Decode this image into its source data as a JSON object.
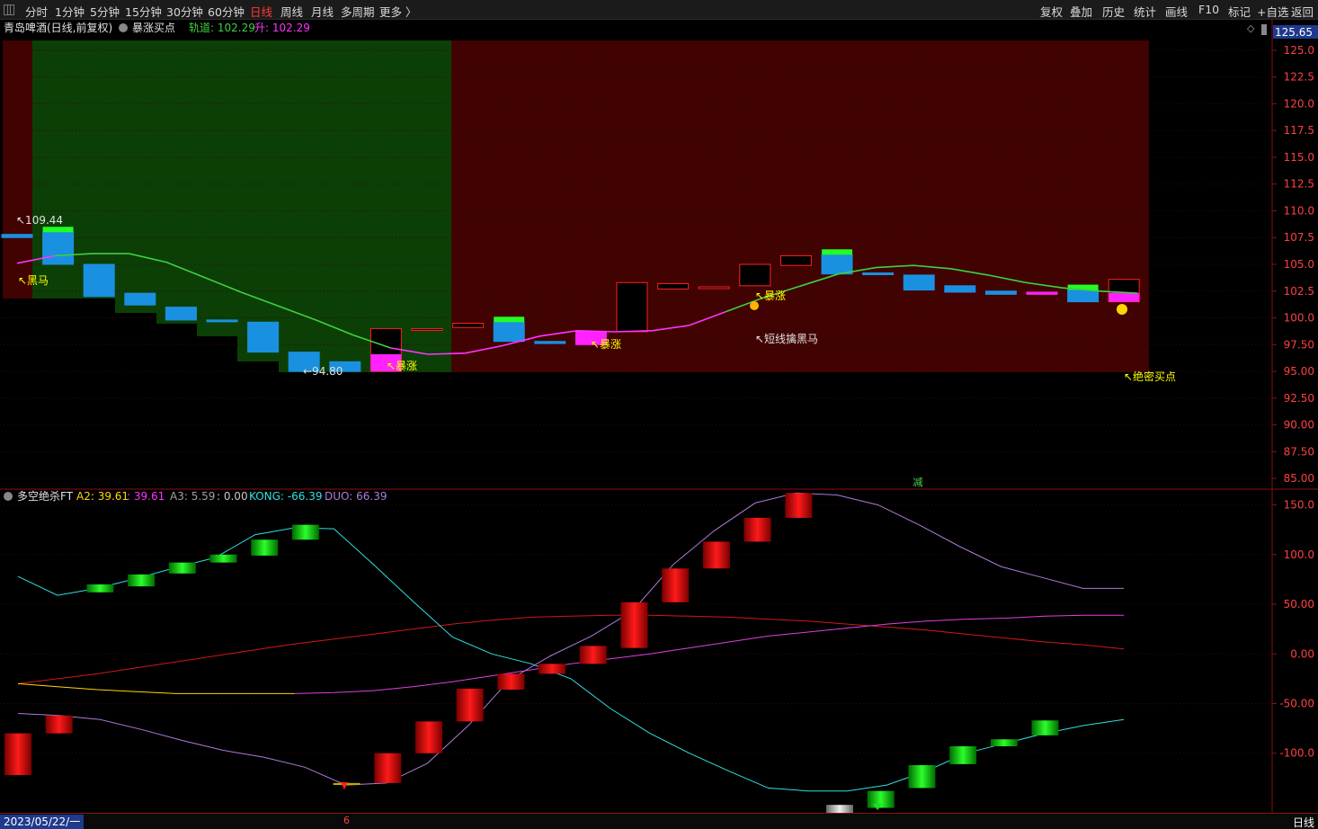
{
  "toolbar": {
    "left": [
      "分时",
      "1分钟",
      "5分钟",
      "15分钟",
      "30分钟",
      "60分钟",
      "日线",
      "周线",
      "月线",
      "多周期",
      "更多 〉"
    ],
    "right": [
      "复权",
      "叠加",
      "历史",
      "统计",
      "画线",
      "F10",
      "标记",
      "+自选",
      "返回"
    ],
    "active": "日线"
  },
  "main_panel": {
    "stock_title": "青岛啤酒(日线,前复权)",
    "indicator_name": "暴涨买点",
    "legend": [
      {
        "label": "轨道: 102.29",
        "color": "#3ed13e"
      },
      {
        "label": "升: 102.29",
        "color": "#ff34ff"
      }
    ],
    "current_price_tag": "125.65",
    "y_axis": {
      "min": 84,
      "max": 126,
      "ticks": [
        "125.0",
        "122.5",
        "120.0",
        "117.5",
        "115.0",
        "112.5",
        "110.0",
        "107.5",
        "105.0",
        "102.5",
        "100.0",
        "97.50",
        "95.00",
        "92.50",
        "90.00",
        "87.50",
        "85.00"
      ]
    },
    "annotations": {
      "high": "109.44",
      "low": "94.80",
      "heima": "黑马",
      "baozhang": "暴涨",
      "short_line": "短线擒黑马",
      "secret_point": "绝密买点",
      "reduce": "减"
    }
  },
  "sub_panel": {
    "indicator_name": "多空绝杀FT",
    "legend": [
      {
        "label": "A2: 39.61",
        "color": "#ffd700"
      },
      {
        "label": ": 39.61",
        "color": "#ff34ff"
      },
      {
        "label": "A3: 5.59",
        "color": "#a0a0a0"
      },
      {
        "label": ": 0.00",
        "color": "#c8c8c8"
      },
      {
        "label": "KONG: -66.39",
        "color": "#2fe0e0"
      },
      {
        "label": "DUO: 66.39",
        "color": "#b07ad8"
      }
    ],
    "y_axis": {
      "min": -160,
      "max": 165,
      "ticks": [
        "150.0",
        "100.0",
        "50.00",
        "0.00",
        "-50.00",
        "-100.0"
      ]
    }
  },
  "bottom": {
    "date": "2023/05/22/一",
    "period": "日线",
    "mark": "6"
  },
  "colors": {
    "up": "#ff2020",
    "down": "#1a90e0",
    "green_zone": "#0b3f06",
    "red_zone": "#410202",
    "grid": "#5a0a0a"
  },
  "chart_data": {
    "type": "candlestick",
    "candles": [
      {
        "o": 107.8,
        "c": 107.5,
        "h": 107.9,
        "l": 107.4
      },
      {
        "o": 108.0,
        "c": 105.0,
        "h": 108.0,
        "l": 105.0
      },
      {
        "o": 105.0,
        "c": 102.0,
        "h": 105.0,
        "l": 102.0
      },
      {
        "o": 102.3,
        "c": 101.2,
        "h": 102.3,
        "l": 101.2
      },
      {
        "o": 101.0,
        "c": 99.8,
        "h": 101.0,
        "l": 99.8
      },
      {
        "o": 99.8,
        "c": 99.7,
        "h": 99.9,
        "l": 99.6
      },
      {
        "o": 99.6,
        "c": 96.8,
        "h": 99.6,
        "l": 96.8
      },
      {
        "o": 96.8,
        "c": 95.0,
        "h": 96.8,
        "l": 94.8
      },
      {
        "o": 95.9,
        "c": 95.0,
        "h": 95.9,
        "l": 95.0
      },
      {
        "o": 95.0,
        "c": 99.0,
        "h": 99.0,
        "l": 95.0
      },
      {
        "o": 99.0,
        "c": 99.0,
        "h": 99.1,
        "l": 98.9
      },
      {
        "o": 99.1,
        "c": 99.5,
        "h": 99.6,
        "l": 99.1
      },
      {
        "o": 99.6,
        "c": 97.8,
        "h": 99.6,
        "l": 97.8
      },
      {
        "o": 97.8,
        "c": 97.6,
        "h": 97.8,
        "l": 97.5
      },
      {
        "o": 97.5,
        "c": 98.7,
        "h": 98.7,
        "l": 97.5
      },
      {
        "o": 98.7,
        "c": 103.3,
        "h": 103.3,
        "l": 98.7
      },
      {
        "o": 102.7,
        "c": 103.2,
        "h": 103.2,
        "l": 102.7
      },
      {
        "o": 102.8,
        "c": 102.9,
        "h": 102.9,
        "l": 102.7
      },
      {
        "o": 103.0,
        "c": 105.0,
        "h": 105.0,
        "l": 103.0
      },
      {
        "o": 104.9,
        "c": 105.8,
        "h": 105.8,
        "l": 104.9
      },
      {
        "o": 105.9,
        "c": 104.1,
        "h": 105.9,
        "l": 104.1
      },
      {
        "o": 104.2,
        "c": 104.1,
        "h": 104.2,
        "l": 104.0
      },
      {
        "o": 104.0,
        "c": 102.6,
        "h": 104.0,
        "l": 102.6
      },
      {
        "o": 103.0,
        "c": 102.4,
        "h": 103.0,
        "l": 102.4
      },
      {
        "o": 102.5,
        "c": 102.2,
        "h": 102.5,
        "l": 102.2
      },
      {
        "o": 102.2,
        "c": 102.4,
        "h": 102.5,
        "l": 102.2
      },
      {
        "o": 102.6,
        "c": 101.5,
        "h": 102.6,
        "l": 101.5
      },
      {
        "o": 101.5,
        "c": 103.6,
        "h": 103.6,
        "l": 101.5
      }
    ],
    "cap_up": [
      null,
      true,
      null,
      null,
      null,
      null,
      null,
      null,
      null,
      null,
      null,
      null,
      true,
      null,
      null,
      null,
      null,
      null,
      null,
      null,
      true,
      null,
      null,
      null,
      null,
      null,
      true,
      null
    ],
    "magenta_body": [
      null,
      null,
      null,
      null,
      null,
      null,
      null,
      null,
      null,
      true,
      null,
      null,
      null,
      null,
      true,
      null,
      null,
      null,
      null,
      null,
      null,
      null,
      null,
      null,
      null,
      true,
      null,
      true
    ],
    "rail": [
      105.1,
      105.8,
      106.0,
      106.0,
      105.2,
      103.8,
      102.4,
      101.1,
      99.8,
      98.4,
      97.2,
      96.6,
      96.7,
      97.4,
      98.3,
      98.8,
      98.7,
      98.8,
      99.3,
      100.6,
      101.9,
      103.0,
      104.1,
      104.7,
      104.9,
      104.6,
      104.0,
      103.3,
      102.8,
      102.5,
      102.3
    ],
    "rail_green_until": 10,
    "rail_green_from": 19,
    "sub_bars": [
      {
        "lo": -122,
        "hi": -80,
        "c": "r"
      },
      {
        "lo": -80,
        "hi": -62,
        "c": "r"
      },
      {
        "lo": 62,
        "hi": 70,
        "c": "g"
      },
      {
        "lo": 68,
        "hi": 80,
        "c": "g"
      },
      {
        "lo": 81,
        "hi": 92,
        "c": "g"
      },
      {
        "lo": 92,
        "hi": 100,
        "c": "g"
      },
      {
        "lo": 99,
        "hi": 115,
        "c": "g"
      },
      {
        "lo": 115,
        "hi": 130,
        "c": "g"
      },
      {
        "lo": -132,
        "hi": -130,
        "c": "y"
      },
      {
        "lo": -130,
        "hi": -100,
        "c": "r"
      },
      {
        "lo": -100,
        "hi": -68,
        "c": "r"
      },
      {
        "lo": -68,
        "hi": -35,
        "c": "r"
      },
      {
        "lo": -36,
        "hi": -20,
        "c": "r"
      },
      {
        "lo": -20,
        "hi": -10,
        "c": "r"
      },
      {
        "lo": -10,
        "hi": 8,
        "c": "r"
      },
      {
        "lo": 6,
        "hi": 52,
        "c": "r"
      },
      {
        "lo": 52,
        "hi": 86,
        "c": "r"
      },
      {
        "lo": 86,
        "hi": 113,
        "c": "r"
      },
      {
        "lo": 113,
        "hi": 137,
        "c": "r"
      },
      {
        "lo": 137,
        "hi": 162,
        "c": "r"
      },
      {
        "lo": -160,
        "hi": -152,
        "c": "w"
      },
      {
        "lo": -155,
        "hi": -138,
        "c": "g"
      },
      {
        "lo": -135,
        "hi": -112,
        "c": "g"
      },
      {
        "lo": -111,
        "hi": -93,
        "c": "g"
      },
      {
        "lo": -93,
        "hi": -86,
        "c": "g"
      },
      {
        "lo": -82,
        "hi": -67,
        "c": "g"
      }
    ],
    "kong": [
      78,
      59,
      66,
      76,
      87,
      97,
      120,
      127,
      126,
      90,
      53,
      17,
      0,
      -10,
      -25,
      -55,
      -80,
      -100,
      -118,
      -135,
      -138,
      -138,
      -132,
      -118,
      -100,
      -90,
      -80,
      -72,
      -66
    ],
    "duo": [
      -60,
      -62,
      -66,
      -76,
      -87,
      -97,
      -104,
      -114,
      -132,
      -130,
      -110,
      -72,
      -26,
      -2,
      18,
      43,
      90,
      124,
      152,
      162,
      160,
      150,
      130,
      108,
      88,
      77,
      66,
      66
    ],
    "red_line": [
      -30,
      -25,
      -20,
      -14,
      -8,
      -2,
      4,
      10,
      15,
      20,
      25,
      30,
      34,
      37,
      38,
      39,
      39,
      38,
      37,
      35,
      33,
      30,
      27,
      24,
      20,
      16,
      12,
      9,
      5
    ],
    "magenta_line": [
      -30,
      -33,
      -36,
      -38,
      -40,
      -40,
      -40,
      -40,
      -39,
      -37,
      -33,
      -28,
      -22,
      -16,
      -10,
      -5,
      0,
      6,
      12,
      18,
      22,
      26,
      30,
      33,
      35,
      36,
      38,
      39,
      39
    ],
    "yellow_until": 7
  }
}
